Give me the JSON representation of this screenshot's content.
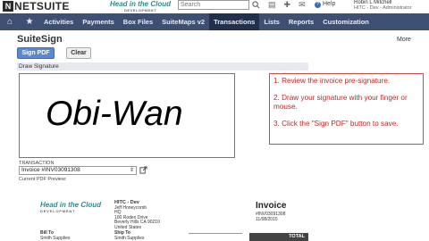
{
  "header": {
    "logo_mark": "N",
    "logo_text": "NETSUITE",
    "brand_name": "Head in the Cloud",
    "brand_tagline": "DEVELOPMENT",
    "search_placeholder": "Search",
    "help_label": "Help",
    "user_name": "Robin L Mitchell",
    "user_role": "HITC - Dev - Administrator"
  },
  "nav": {
    "items": [
      {
        "label": "Activities"
      },
      {
        "label": "Payments"
      },
      {
        "label": "Box Files"
      },
      {
        "label": "SuiteMaps v2"
      },
      {
        "label": "Transactions"
      },
      {
        "label": "Lists"
      },
      {
        "label": "Reports"
      },
      {
        "label": "Customization"
      }
    ],
    "active": "Transactions"
  },
  "page": {
    "title": "SuiteSign",
    "more_label": "More",
    "sign_pdf_label": "Sign PDF",
    "clear_label": "Clear",
    "section_label": "Draw Signature",
    "signature_text": "Obi-Wan",
    "transaction_label": "TRANSACTION",
    "transaction_value": "Invoice #INV03091308",
    "preview_label": "Current PDF Preview:"
  },
  "instructions": {
    "step1": "1. Review the invoice pre-signature.",
    "step2": "2. Draw your signature with your finger or mouse.",
    "step3": "3. Click the \"Sign PDF\" button to save."
  },
  "pdf": {
    "brand_name": "Head in the Cloud",
    "brand_tagline": "DEVELOPMENT",
    "company": "HITC - Dev",
    "addr_line1": "Jeff Honeycomb",
    "addr_line2": "HQ",
    "addr_line3": "100 Rodeo Drive",
    "addr_line4": "Beverly Hills CA 90210",
    "addr_line5": "United States",
    "invoice_title": "Invoice",
    "invoice_number": "#INV03091308",
    "invoice_date": "11/08/2015",
    "bill_to_label": "Bill To",
    "bill_to_value": "Smith Supplies",
    "ship_to_label": "Ship To",
    "ship_to_value": "Smith Supplies",
    "total_label": "TOTAL"
  },
  "colors": {
    "nav_bg": "#3e4f74",
    "nav_active": "#23304d",
    "primary_button": "#5a87d6",
    "instruction_red": "#cc2222",
    "brand_teal": "#2a8d8d"
  }
}
